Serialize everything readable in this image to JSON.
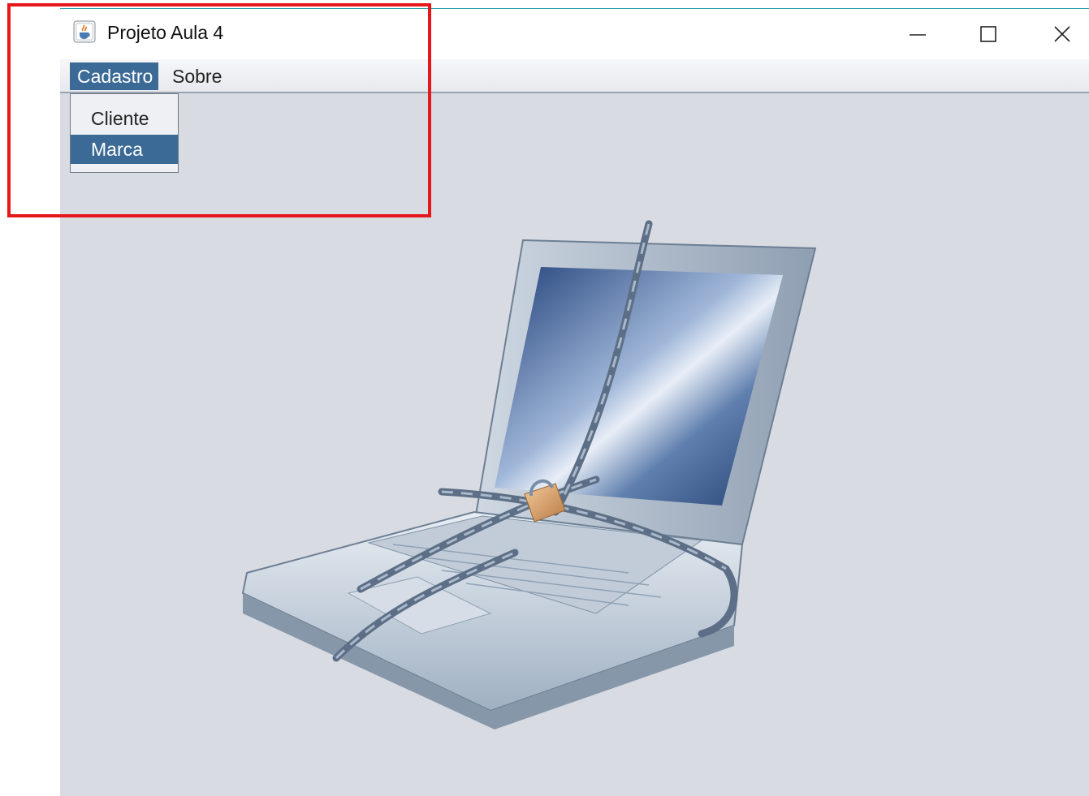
{
  "window": {
    "title": "Projeto Aula 4",
    "icon": "java-cup-icon",
    "controls": {
      "minimize": "minimize-icon",
      "maximize": "maximize-icon",
      "close": "close-icon"
    }
  },
  "menubar": {
    "items": [
      {
        "label": "Cadastro",
        "active": true
      },
      {
        "label": "Sobre",
        "active": false
      }
    ]
  },
  "dropdown": {
    "items": [
      {
        "label": "Cliente",
        "highlighted": false
      },
      {
        "label": "Marca",
        "highlighted": true
      }
    ]
  },
  "content": {
    "image": "chained-laptop-image"
  },
  "annotation": {
    "type": "red-highlight-box",
    "color": "#e5171a"
  },
  "colors": {
    "menu_selected": "#3b6a96",
    "background": "#d8dbe2"
  }
}
